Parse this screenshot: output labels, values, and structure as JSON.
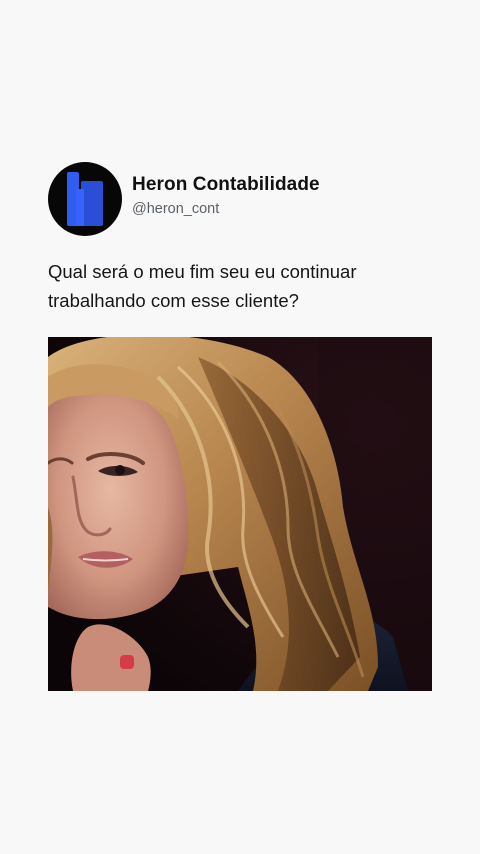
{
  "post": {
    "author": {
      "display_name": "Heron Contabilidade",
      "handle": "@heron_cont",
      "avatar_icon": "heron-logo-icon",
      "avatar_bg": "#070707",
      "logo_color": "#2f5df2"
    },
    "text": "Qual será o meu fim seu eu continuar trabalhando com esse cliente?",
    "media": {
      "type": "photo",
      "subject": "woman-with-wavy-blonde-hair"
    }
  },
  "colors": {
    "page_bg": "#f8f8f9",
    "text": "#111111",
    "handle_text": "#5b6168",
    "brand_blue": "#2f5df2"
  }
}
